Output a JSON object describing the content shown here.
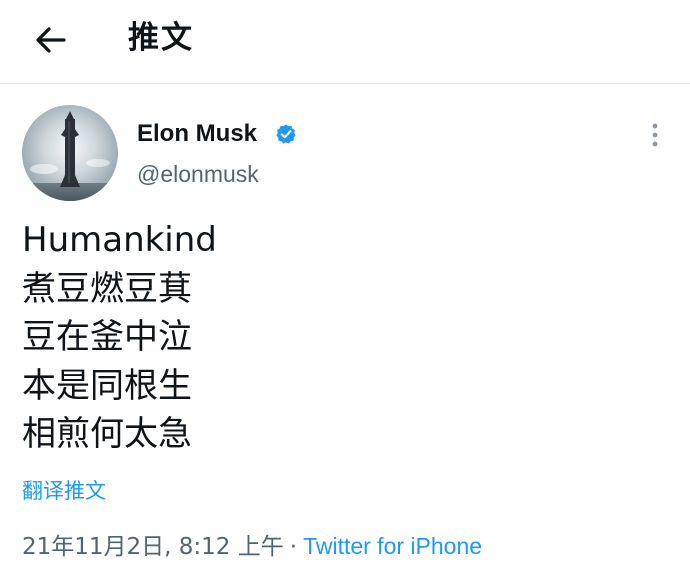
{
  "header": {
    "back_icon": "arrow-left-icon",
    "title": "推文"
  },
  "author": {
    "name": "Elon Musk",
    "handle": "@elonmusk",
    "verified_icon": "verified-badge-icon",
    "verified_color": "#1d9bf0",
    "avatar_icon": "starship-avatar"
  },
  "more_icon": "vertical-ellipsis-icon",
  "tweet": {
    "lines": [
      "Humankind",
      "煮豆燃豆萁",
      "豆在釜中泣",
      "本是同根生",
      "相煎何太急"
    ],
    "translate_label": "翻译推文"
  },
  "meta": {
    "timestamp": "21年11月2日, 8:12 上午",
    "separator": "·",
    "source": "Twitter for iPhone"
  },
  "colors": {
    "accent": "#1d9bf0",
    "text": "#0f1419",
    "secondary_text": "#536471",
    "divider": "#e4e7ea"
  }
}
